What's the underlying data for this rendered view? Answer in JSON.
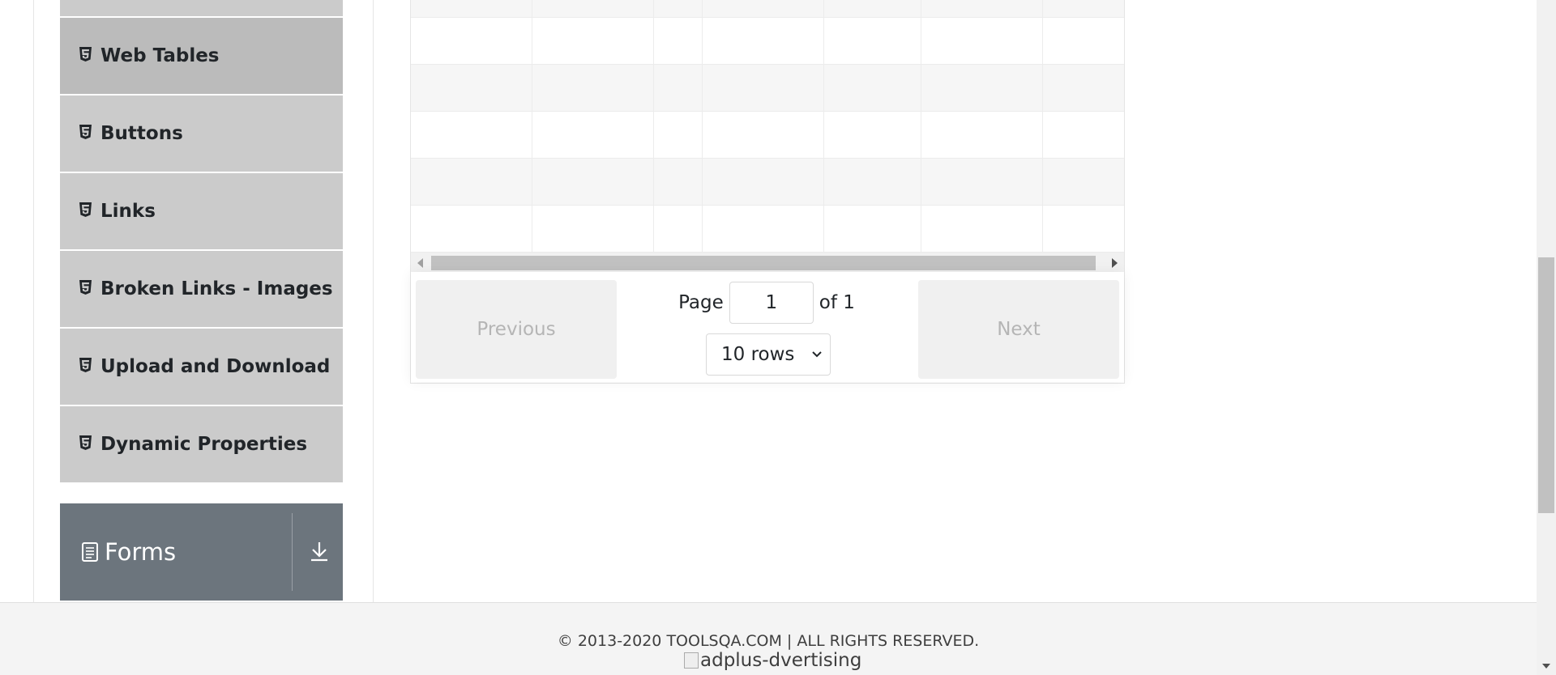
{
  "sidebar": {
    "items": [
      {
        "label": "Web Tables",
        "icon": "html5-icon",
        "active": true
      },
      {
        "label": "Buttons",
        "icon": "html5-icon"
      },
      {
        "label": "Links",
        "icon": "html5-icon"
      },
      {
        "label": "Broken Links - Images",
        "icon": "html5-icon"
      },
      {
        "label": "Upload and Download",
        "icon": "html5-icon"
      },
      {
        "label": "Dynamic Properties",
        "icon": "html5-icon"
      }
    ],
    "group": {
      "label": "Forms",
      "icon": "document-icon",
      "toggle_icon": "download-arrow-icon"
    }
  },
  "table": {
    "pagination": {
      "previous_label": "Previous",
      "next_label": "Next",
      "page_label": "Page",
      "page_value": "1",
      "of_label": "of 1",
      "rows_selected": "10 rows"
    }
  },
  "footer": {
    "copyright": "© 2013-2020 TOOLSQA.COM | ALL RIGHTS RESERVED.",
    "ad_alt": "adplus-dvertising"
  },
  "colors": {
    "menu_bg": "#cbcbcb",
    "menu_active_bg": "#bbbbbb",
    "group_bg": "#6c757d",
    "footer_bg": "#f4f4f4"
  }
}
